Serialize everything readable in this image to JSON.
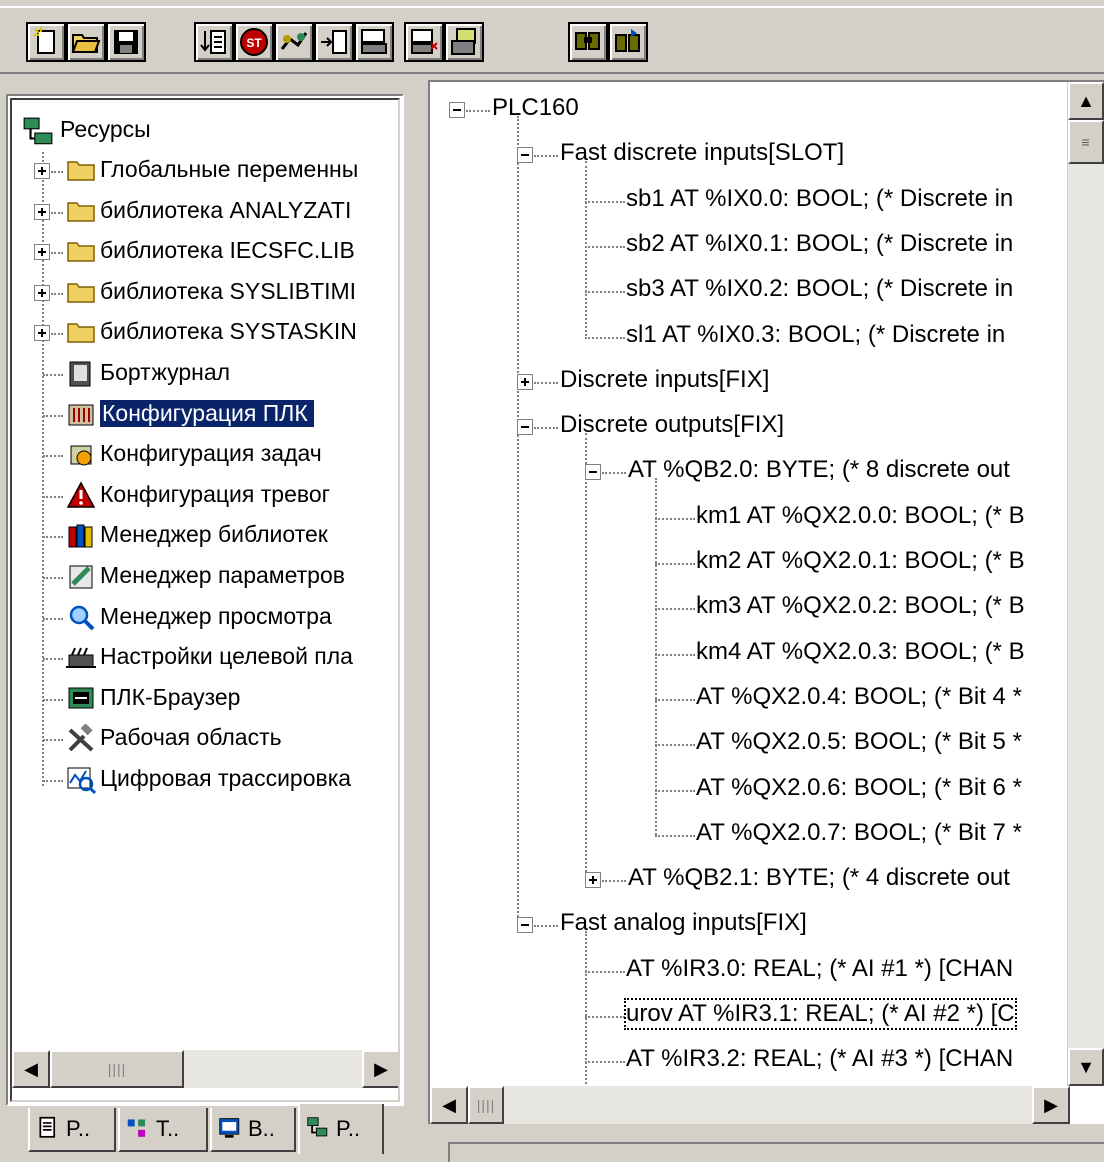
{
  "toolbar": {
    "buttons": [
      {
        "icon": "new-file-icon"
      },
      {
        "icon": "open-folder-icon"
      },
      {
        "icon": "save-disk-icon"
      },
      {
        "icon": "step-in-icon"
      },
      {
        "icon": "stop-icon"
      },
      {
        "icon": "login-icon"
      },
      {
        "icon": "step-over-icon"
      },
      {
        "icon": "online-icon"
      },
      {
        "icon": "online-delete-icon"
      },
      {
        "icon": "download-icon"
      },
      {
        "icon": "find-icon"
      },
      {
        "icon": "find-next-icon"
      }
    ]
  },
  "resources_tree": {
    "root": "Ресурсы",
    "items": [
      {
        "label": "Глобальные переменны",
        "expander": true,
        "icon": "folder-icon"
      },
      {
        "label": "библиотека ANALYZATI",
        "expander": true,
        "icon": "folder-icon"
      },
      {
        "label": "библиотека IECSFC.LIB",
        "expander": true,
        "icon": "folder-icon"
      },
      {
        "label": "библиотека SYSLIBTIMI",
        "expander": true,
        "icon": "folder-icon"
      },
      {
        "label": "библиотека SYSTASKIN",
        "expander": true,
        "icon": "folder-icon"
      },
      {
        "label": "Бортжурнал",
        "expander": false,
        "icon": "log-book-icon"
      },
      {
        "label": "Конфигурация ПЛК",
        "expander": false,
        "icon": "plc-config-icon",
        "selected": true
      },
      {
        "label": "Конфигурация задач",
        "expander": false,
        "icon": "task-config-icon"
      },
      {
        "label": "Конфигурация тревог",
        "expander": false,
        "icon": "alarm-icon"
      },
      {
        "label": "Менеджер библиотек",
        "expander": false,
        "icon": "library-manager-icon"
      },
      {
        "label": "Менеджер параметров",
        "expander": false,
        "icon": "parameter-manager-icon"
      },
      {
        "label": "Менеджер просмотра",
        "expander": false,
        "icon": "watch-manager-icon"
      },
      {
        "label": "Настройки целевой пла",
        "expander": false,
        "icon": "target-settings-icon"
      },
      {
        "label": "ПЛК-Браузер",
        "expander": false,
        "icon": "plc-browser-icon"
      },
      {
        "label": "Рабочая область",
        "expander": false,
        "icon": "workspace-tools-icon"
      },
      {
        "label": "Цифровая трассировка",
        "expander": false,
        "icon": "trace-icon"
      }
    ]
  },
  "tabs": [
    {
      "label": "P..",
      "icon": "pou-tab-icon"
    },
    {
      "label": "T..",
      "icon": "types-tab-icon"
    },
    {
      "label": "B..",
      "icon": "visualization-tab-icon"
    },
    {
      "label": "P..",
      "icon": "resources-tab-icon",
      "active": true
    }
  ],
  "plc_tree": {
    "rows": [
      {
        "level": 0,
        "exp": "minus",
        "text": "PLC160"
      },
      {
        "level": 1,
        "exp": "minus",
        "text": "Fast discrete inputs[SLOT]"
      },
      {
        "level": 2,
        "exp": "none",
        "text": "sb1 AT %IX0.0: BOOL; (* Discrete in"
      },
      {
        "level": 2,
        "exp": "none",
        "text": "sb2 AT %IX0.1: BOOL; (* Discrete in"
      },
      {
        "level": 2,
        "exp": "none",
        "text": "sb3 AT %IX0.2: BOOL; (* Discrete in"
      },
      {
        "level": 2,
        "exp": "none",
        "text": "sl1 AT %IX0.3: BOOL; (* Discrete in"
      },
      {
        "level": 1,
        "exp": "plus",
        "text": "Discrete inputs[FIX]"
      },
      {
        "level": 1,
        "exp": "minus",
        "text": "Discrete outputs[FIX]"
      },
      {
        "level": 2,
        "exp": "minus",
        "text": " AT %QB2.0: BYTE; (* 8 discrete out"
      },
      {
        "level": 3,
        "exp": "none",
        "text": "km1 AT %QX2.0.0: BOOL; (* B"
      },
      {
        "level": 3,
        "exp": "none",
        "text": "km2 AT %QX2.0.1: BOOL; (* B"
      },
      {
        "level": 3,
        "exp": "none",
        "text": "km3 AT %QX2.0.2: BOOL; (* B"
      },
      {
        "level": 3,
        "exp": "none",
        "text": "km4 AT %QX2.0.3: BOOL; (* B"
      },
      {
        "level": 3,
        "exp": "none",
        "text": " AT %QX2.0.4: BOOL; (* Bit 4 *"
      },
      {
        "level": 3,
        "exp": "none",
        "text": " AT %QX2.0.5: BOOL; (* Bit 5 *"
      },
      {
        "level": 3,
        "exp": "none",
        "text": " AT %QX2.0.6: BOOL; (* Bit 6 *"
      },
      {
        "level": 3,
        "exp": "none",
        "text": " AT %QX2.0.7: BOOL; (* Bit 7 *"
      },
      {
        "level": 2,
        "exp": "plus",
        "text": " AT %QB2.1: BYTE; (* 4 discrete out"
      },
      {
        "level": 1,
        "exp": "minus",
        "text": "Fast analog inputs[FIX]"
      },
      {
        "level": 2,
        "exp": "none",
        "text": " AT %IR3.0: REAL; (* AI #1 *) [CHAN"
      },
      {
        "level": 2,
        "exp": "none",
        "text": "urov AT %IR3.1: REAL; (* AI #2 *) [C",
        "focused": true
      },
      {
        "level": 2,
        "exp": "none",
        "text": " AT %IR3.2: REAL; (* AI #3 *) [CHAN"
      }
    ]
  },
  "scroll": {
    "left_h": "||||",
    "right_h": "||||",
    "right_v": "≡"
  }
}
